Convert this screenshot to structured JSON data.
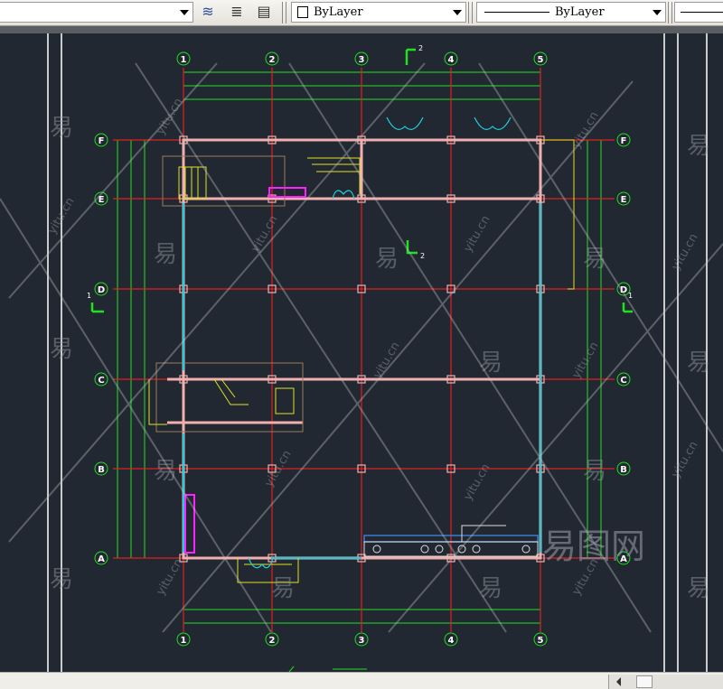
{
  "toolbar": {
    "color_combo": "ByLayer",
    "linetype_combo": "ByLayer",
    "icons": [
      "layer-manager-icon",
      "layer-previous-icon",
      "layer-states-icon"
    ]
  },
  "axes": {
    "columns": [
      "1",
      "2",
      "3",
      "4",
      "5"
    ],
    "rows": [
      "F",
      "E",
      "D",
      "C",
      "B",
      "A"
    ]
  },
  "markers": {
    "section_top": "2",
    "section_mid": "2",
    "section_left": "1",
    "section_right": "1"
  },
  "watermark": {
    "char": "易",
    "site": "yitu.cn",
    "logo": "易图网"
  },
  "colors": {
    "background": "#222831",
    "axis": "#e02020",
    "dim": "#20e020",
    "wall": "#f0b0b0",
    "window": "#20d0e0",
    "stair": "#e0e020"
  }
}
